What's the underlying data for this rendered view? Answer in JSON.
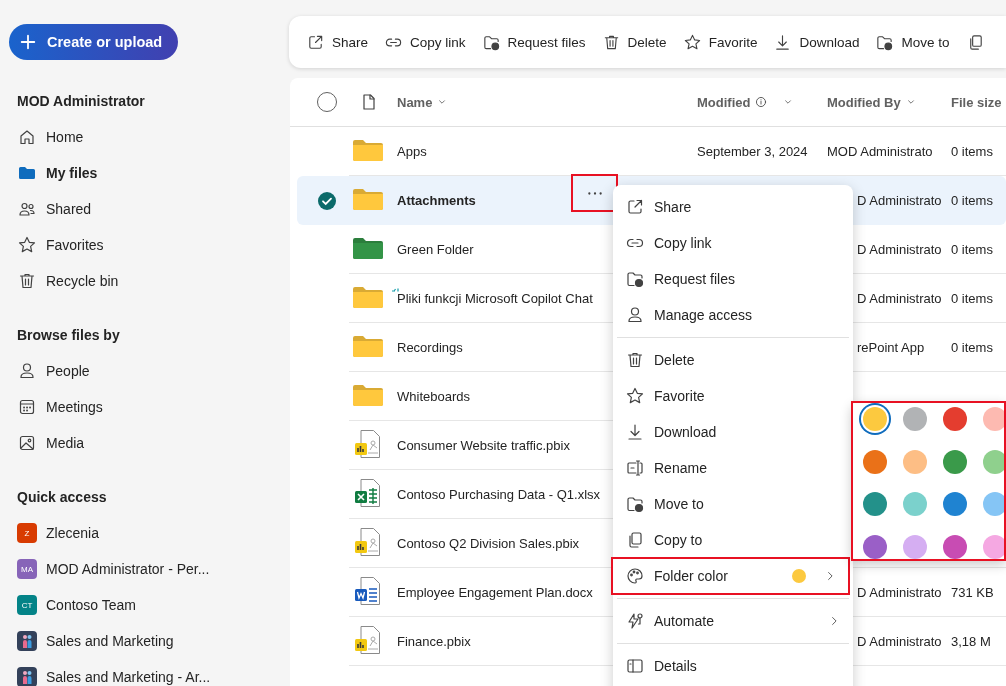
{
  "create_button": {
    "label": "Create or upload"
  },
  "sidebar": {
    "owner": "MOD Administrator",
    "items": [
      {
        "label": "Home",
        "selected": false
      },
      {
        "label": "My files",
        "selected": true
      },
      {
        "label": "Shared",
        "selected": false
      },
      {
        "label": "Favorites",
        "selected": false
      },
      {
        "label": "Recycle bin",
        "selected": false
      }
    ],
    "browse": {
      "heading": "Browse files by",
      "items": [
        {
          "label": "People",
          "selected": false
        },
        {
          "label": "Meetings",
          "selected": false
        },
        {
          "label": "Media",
          "selected": false
        }
      ]
    },
    "quick_access": {
      "heading": "Quick access",
      "items": [
        {
          "kind": "initials",
          "initials": "Z",
          "label": "Zlecenia",
          "color": "#d83b01"
        },
        {
          "kind": "initials",
          "initials": "MA",
          "label": "MOD Administrator - Per...",
          "color": "#8764b8"
        },
        {
          "kind": "initials",
          "initials": "CT",
          "label": "Contoso Team",
          "color": "#038387"
        },
        {
          "kind": "team",
          "label": "Sales and Marketing"
        },
        {
          "kind": "team",
          "label": "Sales and Marketing - Ar..."
        }
      ]
    }
  },
  "toolbar": {
    "items": [
      "Share",
      "Copy link",
      "Request files",
      "Delete",
      "Favorite",
      "Download",
      "Move to"
    ]
  },
  "file_list": {
    "select_all": {
      "checked": false
    },
    "columns": [
      "Name",
      "Modified",
      "Modified By",
      "File size"
    ],
    "rows": [
      {
        "kind": "folder",
        "color": "#ffc83d",
        "name": "Apps",
        "modified": "September 3, 2024",
        "modified_by": "MOD Administrato",
        "size": "0 items",
        "selected": false
      },
      {
        "kind": "folder",
        "color": "#ffc83d",
        "name": "Attachments",
        "modified_by": "D Administrato",
        "size": "0 items",
        "selected": true
      },
      {
        "kind": "folder",
        "color": "#339447",
        "name": "Green Folder",
        "modified_by": "D Administrato",
        "size": "0 items",
        "selected": false
      },
      {
        "kind": "copilot-folder",
        "color": "#ffc83d",
        "name": "Pliki funkcji Microsoft Copilot Chat",
        "modified_by": "D Administrato",
        "size": "0 items",
        "selected": false
      },
      {
        "kind": "folder",
        "color": "#ffc83d",
        "name": "Recordings",
        "modified_by": "rePoint App",
        "size": "0 items",
        "selected": false
      },
      {
        "kind": "folder",
        "color": "#ffc83d",
        "name": "Whiteboards",
        "selected": false
      },
      {
        "kind": "pbix",
        "name": "Consumer Website traffic.pbix",
        "selected": false
      },
      {
        "kind": "xlsx",
        "name": "Contoso Purchasing Data - Q1.xlsx",
        "selected": false
      },
      {
        "kind": "pbix",
        "name": "Contoso Q2 Division Sales.pbix",
        "selected": false
      },
      {
        "kind": "docx",
        "name": "Employee Engagement Plan.docx",
        "modified_by": "D Administrato",
        "size": "731 KB",
        "selected": false
      },
      {
        "kind": "pbix",
        "name": "Finance.pbix",
        "modified_by": "D Administrato",
        "size": "3,18 M",
        "selected": false
      }
    ]
  },
  "context_menu": {
    "anchor_highlighted": true,
    "items": [
      {
        "kind": "item",
        "label": "Share",
        "highlighted": false
      },
      {
        "kind": "item",
        "label": "Copy link",
        "highlighted": false
      },
      {
        "kind": "item",
        "label": "Request files",
        "highlighted": false
      },
      {
        "kind": "item",
        "label": "Manage access",
        "highlighted": false
      },
      {
        "kind": "divider"
      },
      {
        "kind": "item",
        "label": "Delete",
        "highlighted": false
      },
      {
        "kind": "item",
        "label": "Favorite",
        "highlighted": false
      },
      {
        "kind": "item",
        "label": "Download",
        "highlighted": false
      },
      {
        "kind": "item",
        "label": "Rename",
        "highlighted": false
      },
      {
        "kind": "item",
        "label": "Move to",
        "highlighted": false
      },
      {
        "kind": "item",
        "label": "Copy to",
        "highlighted": false
      },
      {
        "kind": "submenu",
        "label": "Folder color",
        "highlighted": true
      },
      {
        "kind": "divider"
      },
      {
        "kind": "submenu",
        "label": "Automate",
        "highlighted": false
      },
      {
        "kind": "divider"
      },
      {
        "kind": "item",
        "label": "Details",
        "highlighted": false
      }
    ]
  },
  "folder_color_palette": {
    "highlighted": true,
    "swatches": [
      {
        "color": "#fcc93f",
        "selected": true
      },
      {
        "color": "#b1b3b5",
        "selected": false
      },
      {
        "color": "#e43d2f",
        "selected": false
      },
      {
        "color": "#fdbab1",
        "selected": false
      },
      {
        "color": "#ea7118",
        "selected": false
      },
      {
        "color": "#fdbe85",
        "selected": false
      },
      {
        "color": "#3a9a4a",
        "selected": false
      },
      {
        "color": "#8fd08d",
        "selected": false
      },
      {
        "color": "#23918a",
        "selected": false
      },
      {
        "color": "#7bd1cc",
        "selected": false
      },
      {
        "color": "#1f83d1",
        "selected": false
      },
      {
        "color": "#85c5f5",
        "selected": false
      },
      {
        "color": "#9a5fc7",
        "selected": false
      },
      {
        "color": "#d5aef2",
        "selected": false
      },
      {
        "color": "#c84cb3",
        "selected": false
      },
      {
        "color": "#f5a8e2",
        "selected": false
      }
    ]
  }
}
